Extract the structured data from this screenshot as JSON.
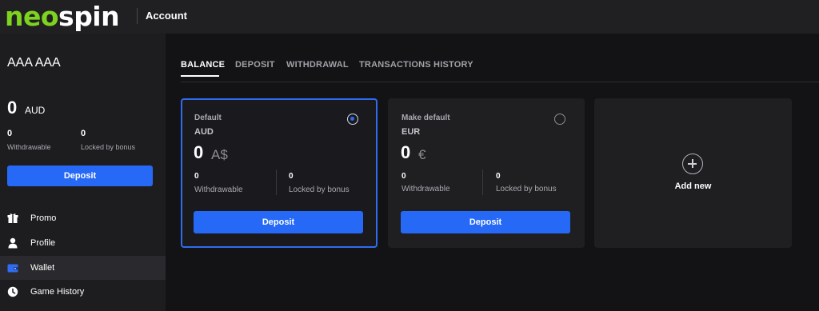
{
  "header": {
    "logo_part1": "neo",
    "logo_part2": "spin",
    "title": "Account"
  },
  "sidebar": {
    "user_name": "AAA AAA",
    "balance_amount": "0",
    "balance_currency": "AUD",
    "withdrawable_value": "0",
    "withdrawable_label": "Withdrawable",
    "locked_value": "0",
    "locked_label": "Locked by bonus",
    "deposit_label": "Deposit",
    "nav": [
      {
        "label": "Promo",
        "icon": "gift-icon"
      },
      {
        "label": "Profile",
        "icon": "user-icon"
      },
      {
        "label": "Wallet",
        "icon": "wallet-icon",
        "active": true
      },
      {
        "label": "Game History",
        "icon": "clock-icon"
      }
    ]
  },
  "tabs": [
    {
      "label": "BALANCE",
      "active": true
    },
    {
      "label": "DEPOSIT"
    },
    {
      "label": "WITHDRAWAL"
    },
    {
      "label": "TRANSACTIONS HISTORY"
    }
  ],
  "cards": [
    {
      "top_label": "Default",
      "currency": "AUD",
      "amount": "0",
      "symbol": "A$",
      "radio_selected": true,
      "withdrawable_value": "0",
      "withdrawable_label": "Withdrawable",
      "locked_value": "0",
      "locked_label": "Locked by bonus",
      "deposit_label": "Deposit"
    },
    {
      "top_label": "Make default",
      "currency": "EUR",
      "amount": "0",
      "symbol": "€",
      "radio_selected": false,
      "withdrawable_value": "0",
      "withdrawable_label": "Withdrawable",
      "locked_value": "0",
      "locked_label": "Locked by bonus",
      "deposit_label": "Deposit"
    }
  ],
  "add_new": {
    "label": "Add new"
  },
  "colors": {
    "brand_green": "#7dd320",
    "accent_blue": "#2569f6",
    "background": "#131316",
    "sidebar_bg": "#1d1d20"
  }
}
